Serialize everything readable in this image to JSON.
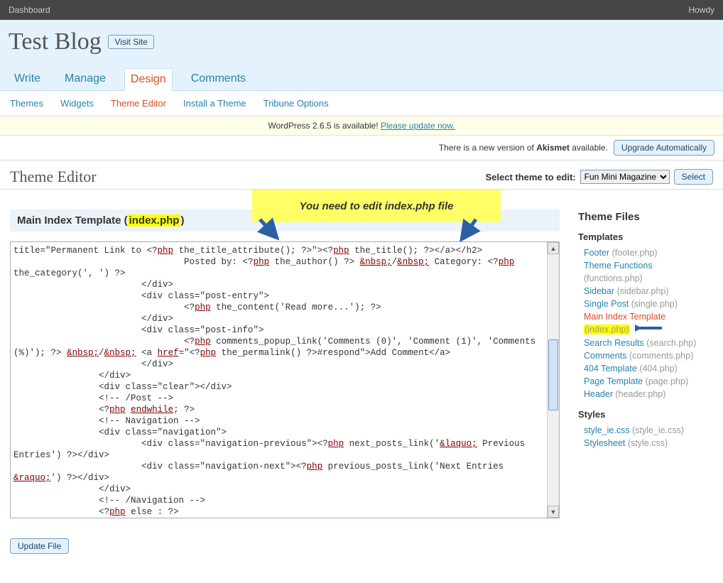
{
  "topbar": {
    "left": "Dashboard",
    "right": "Howdy"
  },
  "header": {
    "blog_title": "Test Blog",
    "visit_site": "Visit Site"
  },
  "mainnav": {
    "items": [
      {
        "label": "Write"
      },
      {
        "label": "Manage"
      },
      {
        "label": "Design",
        "current": true
      },
      {
        "label": "Comments"
      }
    ]
  },
  "subnav": {
    "items": [
      {
        "label": "Themes"
      },
      {
        "label": "Widgets"
      },
      {
        "label": "Theme Editor",
        "current": true
      },
      {
        "label": "Install a Theme"
      },
      {
        "label": "Tribune Options"
      }
    ]
  },
  "notice_update": {
    "prefix": "WordPress 2.6.5 is available! ",
    "link": "Please update now."
  },
  "notice_akismet": {
    "text_prefix": "There is a new version of ",
    "text_strong": "Akismet",
    "text_suffix": " available.",
    "button": "Upgrade Automatically"
  },
  "pagehead": {
    "title": "Theme Editor",
    "select_label": "Select theme to edit:",
    "select_value": "Fun Mini Magazine",
    "select_button": "Select"
  },
  "annotation": {
    "text": "You need to edit index.php file"
  },
  "filetitle": {
    "prefix": "Main Index Template ",
    "paren_open": "(",
    "filename": "index.php",
    "paren_close": ")"
  },
  "editor_code": "title=\"Permanent Link to <?php the_title_attribute(); ?>\"><?php the_title(); ?></a></h2>\n                                Posted by: <?php the_author() ?> &nbsp;/&nbsp; Category: <?php the_category(', ') ?>\n                        </div>\n                        <div class=\"post-entry\">\n                                <?php the_content('Read more...'); ?>\n                        </div>\n                        <div class=\"post-info\">\n                                <?php comments_popup_link('Comments (0)', 'Comment (1)', 'Comments (%)'); ?> &nbsp;/&nbsp; <a href=\"<?php the_permalink() ?>#respond\">Add Comment</a>\n                        </div>\n                </div>\n                <div class=\"clear\"></div>\n                <!-- /Post -->\n                <?php endwhile; ?>\n                <!-- Navigation -->\n                <div class=\"navigation\">\n                        <div class=\"navigation-previous\"><?php next_posts_link('&laquo; Previous Entries') ?></div>\n                        <div class=\"navigation-next\"><?php previous_posts_link('Next Entries &raquo;') ?></div>\n                </div>\n                <!-- /Navigation -->\n                <?php else : ?>\n                <!-- Post -->\n                <div class=\"post\">",
  "update_button": "Update File",
  "sidebar": {
    "heading": "Theme Files",
    "groups": [
      {
        "title": "Templates",
        "items": [
          {
            "label": "Footer",
            "file": "(footer.php)"
          },
          {
            "label": "Theme Functions",
            "file": "(functions.php)"
          },
          {
            "label": "Sidebar",
            "file": "(sidebar.php)"
          },
          {
            "label": "Single Post",
            "file": "(single.php)"
          },
          {
            "label": "Main Index Template",
            "file": "(index.php)",
            "current": true
          },
          {
            "label": "Search Results",
            "file": "(search.php)"
          },
          {
            "label": "Comments",
            "file": "(comments.php)"
          },
          {
            "label": "404 Template",
            "file": "(404.php)"
          },
          {
            "label": "Page Template",
            "file": "(page.php)"
          },
          {
            "label": "Header",
            "file": "(header.php)"
          }
        ]
      },
      {
        "title": "Styles",
        "items": [
          {
            "label": "style_ie.css",
            "file": "(style_ie.css)"
          },
          {
            "label": "Stylesheet",
            "file": "(style.css)"
          }
        ]
      }
    ]
  }
}
